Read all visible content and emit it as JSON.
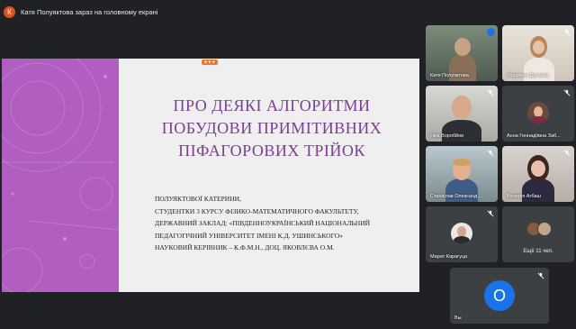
{
  "banner": {
    "avatar_letter": "К",
    "text": "Катя Полуяктова зараз на головному екрані"
  },
  "slide": {
    "recording_badge": "● ● ●",
    "title": "ПРО ДЕЯКІ АЛГОРИТМИ\nПОБУДОВИ ПРИМІТИВНИХ\nПІФАГОРОВИХ ТРІЙОК",
    "lines": [
      "ПОЛУЯКТОВОЇ КАТЕРИНИ,",
      "СТУДЕНТКИ 3 КУРСУ ФІЗИКО-МАТЕМАТИЧНОГО ФАКУЛЬТЕТУ,",
      "ДЕРЖАВНИЙ ЗАКЛАД: «ПІВДЕННОУКРАЇНСЬКИЙ НАЦІОНАЛЬНИЙ",
      "ПЕДАГОГІЧНИЙ УНІВЕРСИТЕТ ІМЕНІ К.Д. УШИНСЬКОГО»",
      "НАУКОВИЙ КЕРІВНИК – К.Ф.М.Н., ДОЦ. ЯКОВЛЄВА О.М."
    ]
  },
  "participants": [
    {
      "name": "Катя Полуяктова"
    },
    {
      "name": "Людмила Драгана"
    },
    {
      "name": "Яків Воробйов"
    },
    {
      "name": "Анна Геннадіївна Заб..."
    },
    {
      "name": "Станіслав Олександ..."
    },
    {
      "name": "Валерія Агбаш"
    },
    {
      "name": "Марат Карагуца"
    },
    {
      "name": "Ещё 11 чел."
    },
    {
      "name": "Вы",
      "initial": "О"
    }
  ],
  "colors": {
    "background": "#202124",
    "slide_purple": "#b05fc0",
    "title_purple": "#7a3f8f",
    "self_avatar": "#1a73e8"
  },
  "icons": [
    "mic-off-icon",
    "speaking-indicator-icon"
  ]
}
